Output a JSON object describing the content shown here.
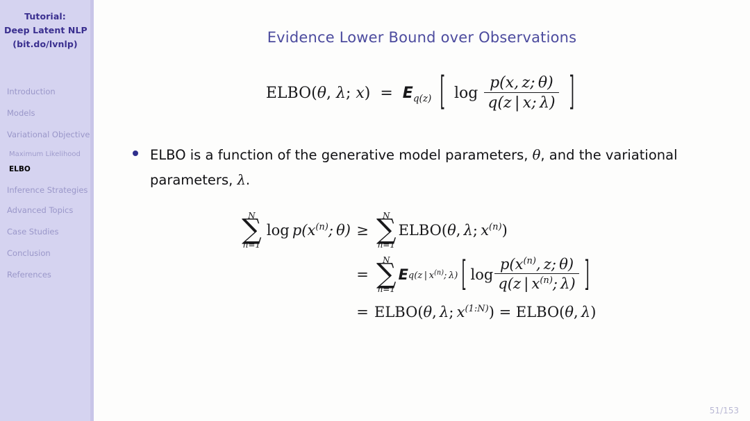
{
  "sidebar": {
    "title_lines": [
      "Tutorial:",
      "Deep Latent NLP",
      "(bit.do/lvnlp)"
    ],
    "items": [
      {
        "label": "Introduction",
        "type": "section",
        "active": false
      },
      {
        "label": "Models",
        "type": "section",
        "active": false
      },
      {
        "label": "Variational Objective",
        "type": "section",
        "active": false
      },
      {
        "label": "Maximum Likelihood",
        "type": "subsection",
        "active": false
      },
      {
        "label": "ELBO",
        "type": "subsection",
        "active": true
      },
      {
        "label": "Inference Strategies",
        "type": "section",
        "active": false
      },
      {
        "label": "Advanced Topics",
        "type": "section",
        "active": false
      },
      {
        "label": "Case Studies",
        "type": "section",
        "active": false
      },
      {
        "label": "Conclusion",
        "type": "section",
        "active": false
      },
      {
        "label": "References",
        "type": "section",
        "active": false
      }
    ],
    "colors": {
      "background": "#d5d3f0",
      "title_color": "#3a2f8f",
      "item_color": "#9a97c9",
      "active_color": "#000000"
    }
  },
  "slide": {
    "title": "Evidence Lower Bound over Observations",
    "title_color": "#4c4b9e",
    "page_number": "51/153",
    "background": "#fdfdfc"
  },
  "equation_main": {
    "lhs": "ELBO(θ, λ; x)",
    "relation": "=",
    "expectation": "E",
    "expectation_subscript": "q(z)",
    "log": "log",
    "fraction_numerator": "p(x, z; θ)",
    "fraction_denominator": "q(z | x; λ)",
    "plain_text": "ELBO(θ, λ; x) = E_q(z)[ log p(x, z; θ) / q(z | x; λ) ]"
  },
  "bullet": {
    "marker_color": "#2f2f8c",
    "text_part1": "ELBO is a function of the generative model parameters, ",
    "symbol1": "θ",
    "text_part2": ", and the variational parameters, ",
    "symbol2": "λ",
    "text_part3": ".",
    "full_text": "ELBO is a function of the generative model parameters, θ, and the variational parameters, λ."
  },
  "equation_block": {
    "line1": {
      "lhs_sum_upper": "N",
      "lhs_sum_lower": "n=1",
      "lhs_body": "log p(x⁽ⁿ⁾; θ)",
      "relation": "≥",
      "rhs_sum_upper": "N",
      "rhs_sum_lower": "n=1",
      "rhs_body": "ELBO(θ, λ; x⁽ⁿ⁾)",
      "plain_text": "Σ_{n=1}^{N} log p(x^(n); θ) ≥ Σ_{n=1}^{N} ELBO(θ, λ; x^(n))"
    },
    "line2": {
      "relation": "=",
      "sum_upper": "N",
      "sum_lower": "n=1",
      "expectation": "E",
      "expectation_subscript": "q(z | x⁽ⁿ⁾; λ)",
      "log": "log",
      "fraction_numerator": "p(x⁽ⁿ⁾, z; θ)",
      "fraction_denominator": "q(z | x⁽ⁿ⁾; λ)",
      "plain_text": "= Σ_{n=1}^{N} E_{q(z | x^(n); λ)}[ log p(x^(n), z; θ) / q(z | x^(n); λ) ]"
    },
    "line3": {
      "relation": "=",
      "term1": "ELBO(θ, λ; x⁽¹:ᴺ⁾)",
      "relation2": "=",
      "term2": "ELBO(θ, λ)",
      "plain_text": "= ELBO(θ, λ; x^(1:N)) = ELBO(θ, λ)"
    }
  }
}
